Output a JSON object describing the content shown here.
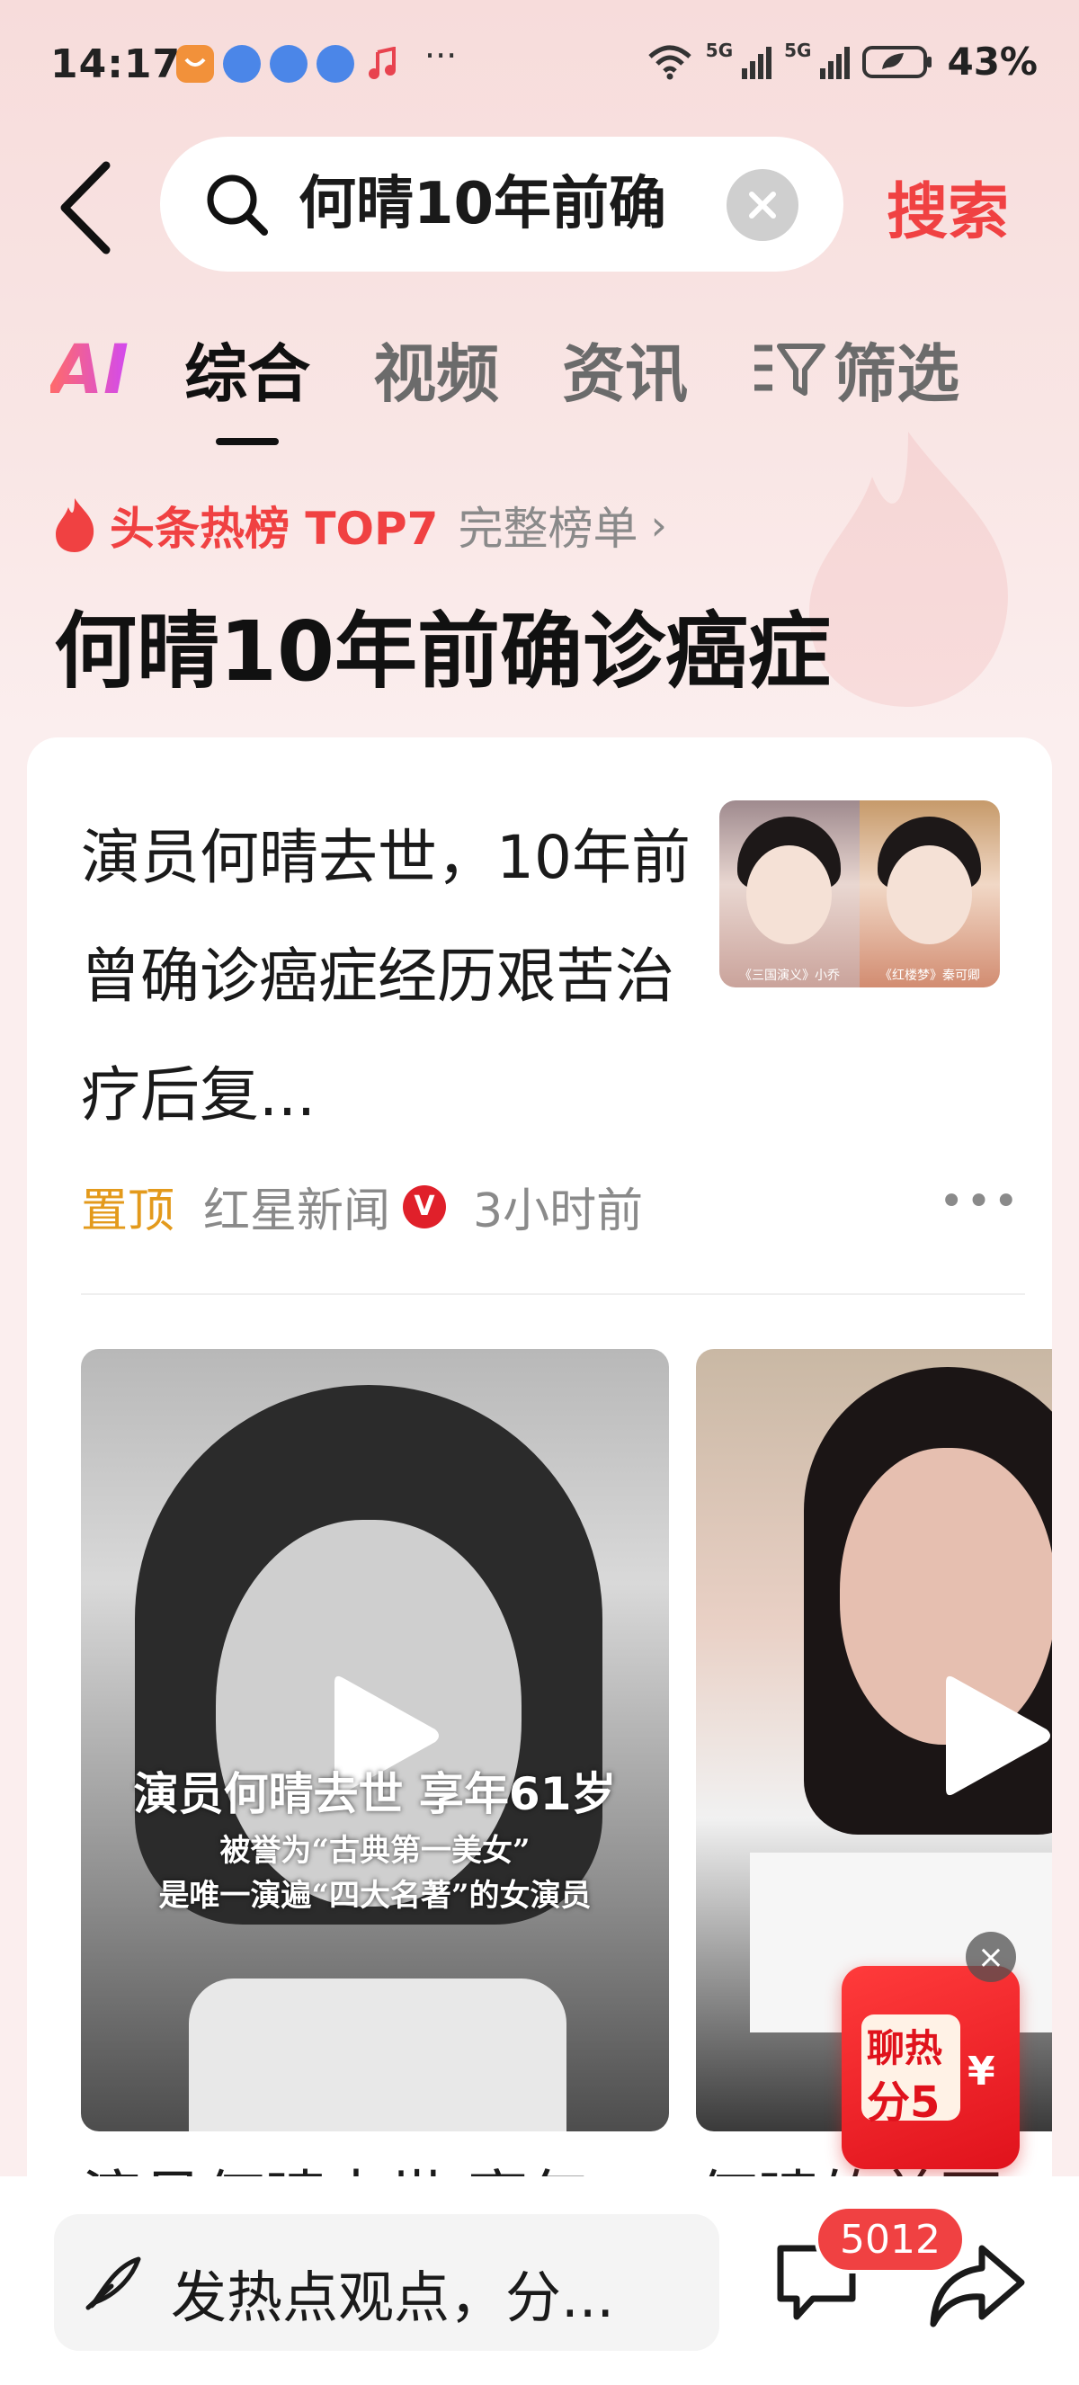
{
  "status_bar": {
    "time": "14:17",
    "network_1": "5G",
    "network_2": "5G",
    "battery": "43%",
    "more": "···"
  },
  "search": {
    "query": "何晴10年前确",
    "button": "搜索"
  },
  "tabs": {
    "ai": "AI",
    "items": [
      "综合",
      "视频",
      "资讯"
    ],
    "active": "综合",
    "filter": "筛选"
  },
  "hot_list": {
    "label": "头条热榜 TOP7",
    "full_list": "完整榜单",
    "topic": "何晴10年前确诊癌症"
  },
  "news": {
    "title": "演员何晴去世，10年前曾确诊癌症经历艰苦治疗后复...",
    "pinned": "置顶",
    "source": "红星新闻",
    "verified_mark": "V",
    "time": "3小时前",
    "thumb_caption_a": "《三国演义》小乔",
    "thumb_caption_b": "《红楼梦》秦可卿"
  },
  "videos": [
    {
      "overlay_title": "演员何晴去世 享年61岁",
      "overlay_line1": "被誉为“古典第一美女”",
      "overlay_line2": "是唯一演遍“四大名著”的女演员",
      "caption": "演员何晴去世 享年"
    },
    {
      "caption": "何晴的美丽"
    }
  ],
  "float_badge": {
    "line1": "聊热",
    "line2": "分5",
    "symbol": "¥"
  },
  "bottom_bar": {
    "comment_placeholder": "发热点观点，分...",
    "comment_count": "5012"
  },
  "colors": {
    "accent": "#f04142",
    "pinned": "#e39a1c",
    "muted": "#8a8a8a"
  }
}
